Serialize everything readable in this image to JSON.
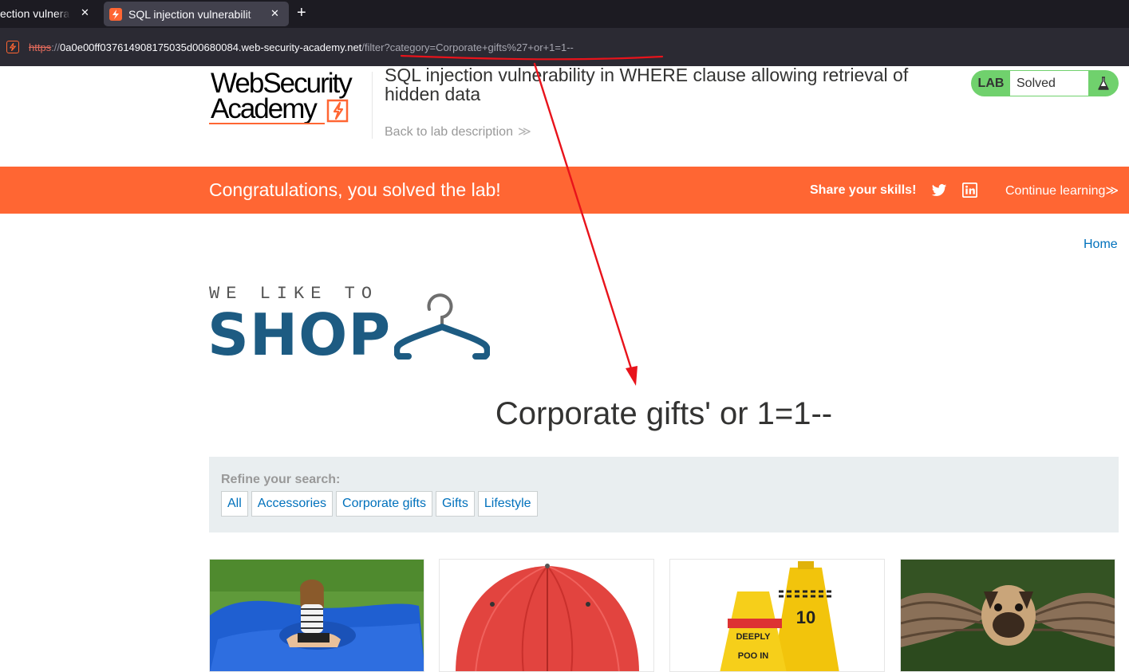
{
  "browser": {
    "tabs": [
      {
        "title": "ection vulnera",
        "close": "✕"
      },
      {
        "title": "SQL injection vulnerabilit",
        "close": "✕"
      }
    ],
    "new_tab": "+",
    "url": {
      "scheme": "https",
      "separator": "://",
      "host": "0a0e00ff037614908175035d00680084.web-security-academy.net",
      "path": "/filter?category=Corporate+gifts%27+or+1=1--"
    }
  },
  "lab_header": {
    "logo_line1": "WebSecurity",
    "logo_line2": "Academy",
    "title": "SQL injection vulnerability in WHERE clause allowing retrieval of hidden data",
    "back_link": "Back to lab description",
    "back_chevron": "≫",
    "status_label": "LAB",
    "status_value": "Solved"
  },
  "banner": {
    "message": "Congratulations, you solved the lab!",
    "share_label": "Share your skills!",
    "continue_label": "Continue learning",
    "continue_chevron": "≫"
  },
  "shop": {
    "home_link": "Home",
    "logo_tagline": "WE LIKE TO",
    "logo_word": "SHOP",
    "heading": "Corporate gifts' or 1=1--",
    "filter": {
      "label": "Refine your search:",
      "categories": [
        "All",
        "Accessories",
        "Corporate gifts",
        "Gifts",
        "Lifestyle"
      ]
    }
  },
  "colors": {
    "accent": "#ff6633",
    "lab_solved": "#70d16d",
    "link": "#0071bc",
    "shop_blue": "#1d5b82",
    "annotation_red": "#e8131b"
  }
}
